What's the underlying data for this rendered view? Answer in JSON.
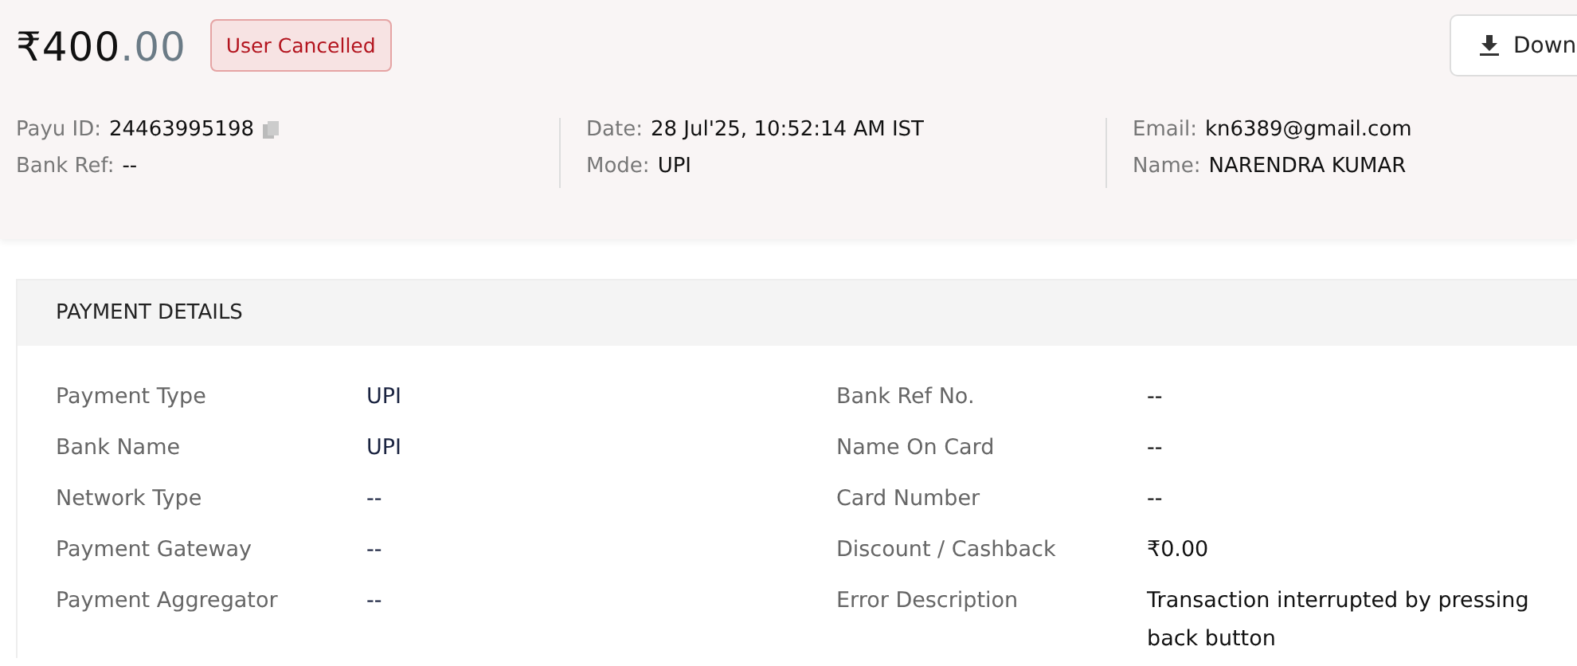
{
  "amount": {
    "whole": "₹400",
    "decimals": ".00"
  },
  "status_badge": "User Cancelled",
  "download_button": {
    "label": "Down"
  },
  "info_columns": [
    {
      "fields": [
        {
          "label": "Payu ID:",
          "value": "24463995198",
          "copyable": true
        },
        {
          "label": "Bank Ref:",
          "value": "--",
          "copyable": false
        }
      ]
    },
    {
      "fields": [
        {
          "label": "Date:",
          "value": "28 Jul'25, 10:52:14 AM IST",
          "copyable": false
        },
        {
          "label": "Mode:",
          "value": "UPI",
          "copyable": false
        }
      ]
    },
    {
      "fields": [
        {
          "label": "Email:",
          "value": "kn6389@gmail.com",
          "copyable": false
        },
        {
          "label": "Name:",
          "value": "NARENDRA KUMAR",
          "copyable": false
        }
      ]
    }
  ],
  "payment_details": {
    "title": "PAYMENT DETAILS",
    "columns": [
      [
        {
          "label": "Payment Type",
          "value": "UPI"
        },
        {
          "label": "Bank Name",
          "value": "UPI"
        },
        {
          "label": "Network Type",
          "value": "--"
        },
        {
          "label": "Payment Gateway",
          "value": "--"
        },
        {
          "label": "Payment Aggregator",
          "value": "--"
        }
      ],
      [
        {
          "label": "Bank Ref No.",
          "value": "--"
        },
        {
          "label": "Name On Card",
          "value": "--"
        },
        {
          "label": "Card Number",
          "value": "--"
        },
        {
          "label": "Discount / Cashback",
          "value": "₹0.00"
        },
        {
          "label": "Error Description",
          "value": "Transaction interrupted by pressing back button"
        }
      ]
    ]
  }
}
